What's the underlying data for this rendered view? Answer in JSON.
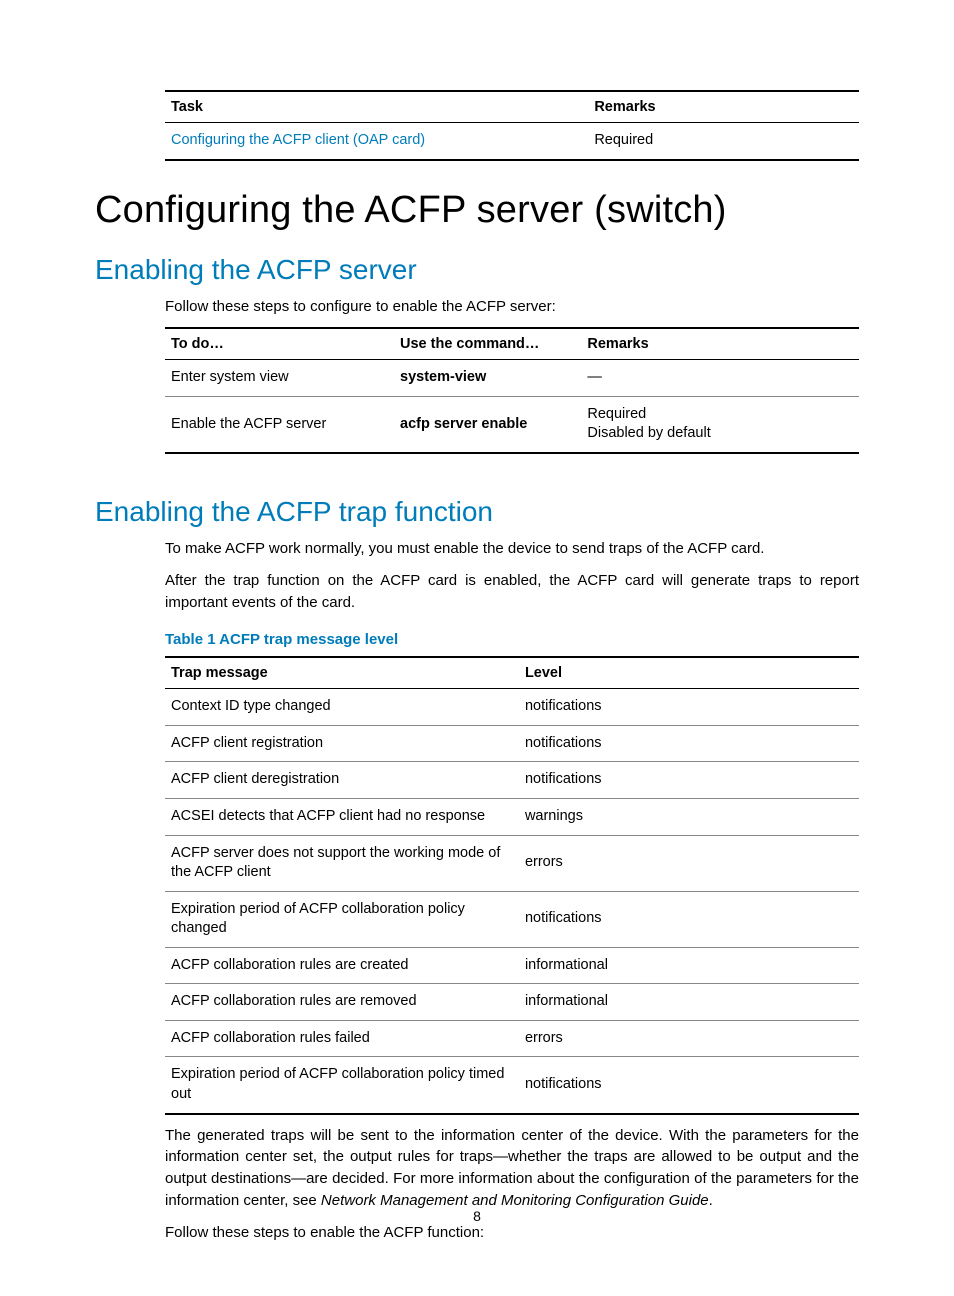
{
  "topTable": {
    "headers": [
      "Task",
      "Remarks"
    ],
    "row": {
      "task": "Configuring the ACFP client (OAP card)",
      "remarks": "Required"
    }
  },
  "h1": "Configuring the ACFP server (switch)",
  "section1": {
    "title": "Enabling the ACFP server",
    "intro": "Follow these steps to configure to enable the ACFP server:",
    "table": {
      "headers": [
        "To do…",
        "Use the command…",
        "Remarks"
      ],
      "rows": [
        {
          "todo": "Enter system view",
          "cmd": "system-view",
          "remarks": "—"
        },
        {
          "todo": "Enable the ACFP server",
          "cmd": "acfp server enable",
          "remarks": "Required\nDisabled by default"
        }
      ]
    }
  },
  "section2": {
    "title": "Enabling the ACFP trap function",
    "p1": "To make ACFP work normally, you must enable the device to send traps of the ACFP card.",
    "p2": "After the trap function on the ACFP card is enabled, the ACFP card will generate traps to report important events of the card.",
    "caption": "Table 1 ACFP trap message level",
    "table": {
      "headers": [
        "Trap message",
        "Level"
      ],
      "rows": [
        {
          "msg": "Context ID type changed",
          "lvl": "notifications"
        },
        {
          "msg": "ACFP client registration",
          "lvl": "notifications"
        },
        {
          "msg": "ACFP client deregistration",
          "lvl": "notifications"
        },
        {
          "msg": "ACSEI detects that ACFP client had no response",
          "lvl": "warnings"
        },
        {
          "msg": "ACFP server does not support the working mode of the ACFP client",
          "lvl": "errors"
        },
        {
          "msg": "Expiration period of ACFP collaboration policy changed",
          "lvl": "notifications"
        },
        {
          "msg": "ACFP collaboration rules are created",
          "lvl": "informational"
        },
        {
          "msg": "ACFP collaboration rules are removed",
          "lvl": "informational"
        },
        {
          "msg": "ACFP collaboration rules failed",
          "lvl": "errors"
        },
        {
          "msg": "Expiration period of ACFP collaboration policy timed out",
          "lvl": "notifications"
        }
      ]
    },
    "p3a": "The generated traps will be sent to the information center of the device. With the parameters for the information center set, the output rules for traps—whether the traps are allowed to be output and the output destinations—are decided. For more information about the configuration of the parameters for the information center, see ",
    "p3b": "Network Management and Monitoring Configuration Guide",
    "p3c": ".",
    "p4": "Follow these steps to enable the ACFP function:"
  },
  "pageNumber": "8"
}
